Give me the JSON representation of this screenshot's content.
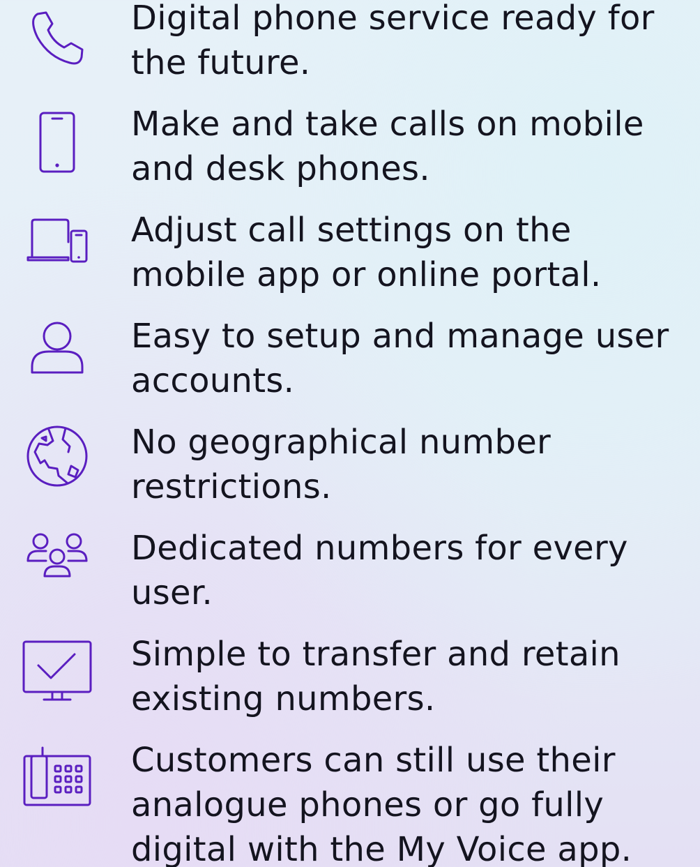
{
  "colors": {
    "icon": "#5a1ec0",
    "text": "#14141f",
    "background_top": "#e7f1f8",
    "background_bottom": "#e4e0f4"
  },
  "features": [
    {
      "icon": "phone-handset-icon",
      "text": "Digital phone service ready for the future."
    },
    {
      "icon": "mobile-phone-icon",
      "text": "Make and take calls on mobile and desk phones."
    },
    {
      "icon": "laptop-and-phone-icon",
      "text": "Adjust call settings on the mobile app or online portal."
    },
    {
      "icon": "user-icon",
      "text": "Easy to setup and manage user accounts."
    },
    {
      "icon": "globe-icon",
      "text": "No geographical number restrictions."
    },
    {
      "icon": "user-group-icon",
      "text": "Dedicated numbers for every user."
    },
    {
      "icon": "monitor-checkmark-icon",
      "text": "Simple to transfer and retain existing numbers."
    },
    {
      "icon": "desk-phone-icon",
      "text": "Customers can still use their analogue phones or go fully digital with the My Voice app."
    }
  ]
}
